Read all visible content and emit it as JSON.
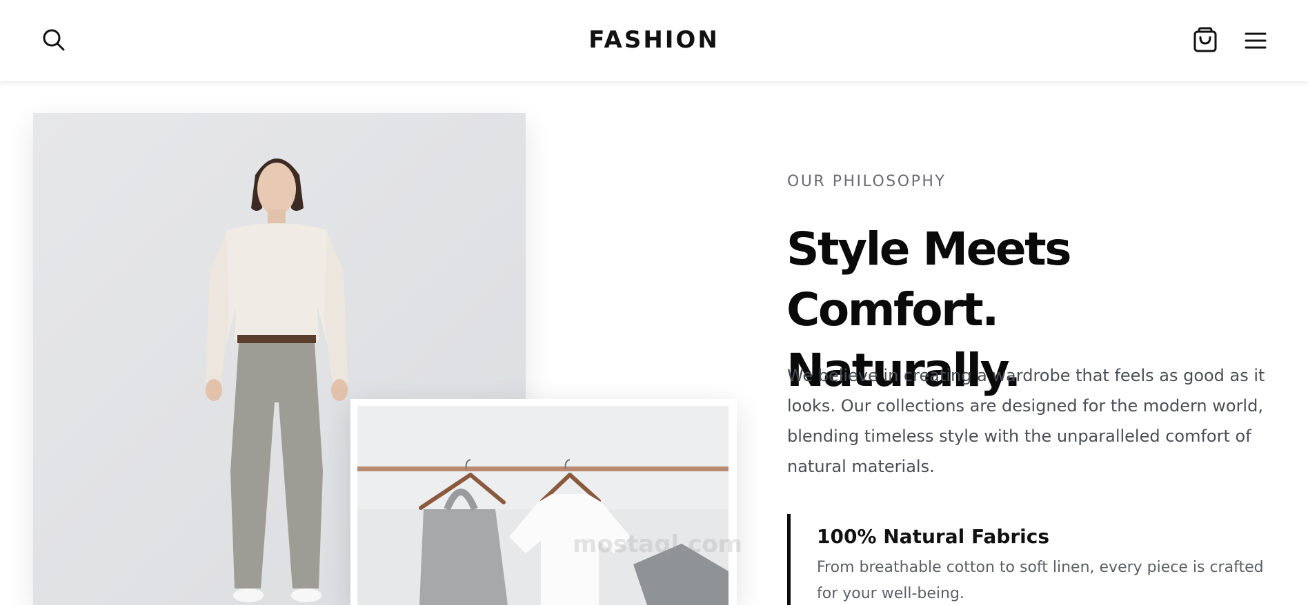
{
  "header": {
    "brand": "FASHION",
    "icons": {
      "search": "search-icon",
      "cart": "shopping-bag-icon",
      "menu": "hamburger-menu-icon"
    }
  },
  "images": {
    "main": "Model in cream sweater and grey trousers",
    "secondary": "Clothing rack with tote bag and white t-shirt on wooden hangers"
  },
  "philosophy": {
    "eyebrow": "OUR PHILOSOPHY",
    "headline_line1": "Style Meets Comfort.",
    "headline_line2": "Naturally.",
    "body": "We believe in creating a wardrobe that feels as good as it looks. Our collections are designed for the modern world, blending timeless style with the unparalleled comfort of natural materials."
  },
  "feature": {
    "title": "100% Natural Fabrics",
    "text": "From breathable cotton to soft linen, every piece is crafted for your well-being."
  },
  "watermark": {
    "text": "mostaql.com"
  },
  "colors": {
    "text_primary": "#0a0a0a",
    "text_muted": "#6b6b70",
    "body": "#4a4d55",
    "accent_border": "#0a0a0a"
  }
}
